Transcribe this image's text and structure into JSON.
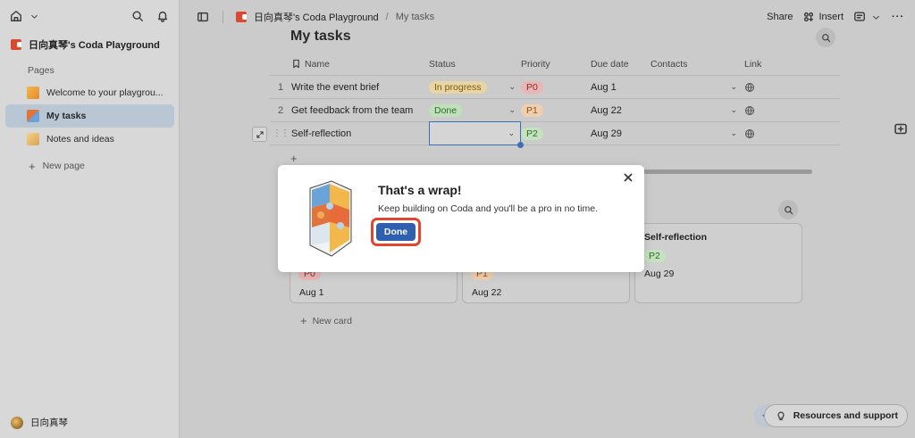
{
  "sidebar": {
    "doc_title": "日向真琴's Coda Playground",
    "pages_label": "Pages",
    "items": [
      {
        "label": "Welcome to your playgrou..."
      },
      {
        "label": "My tasks"
      },
      {
        "label": "Notes and ideas"
      }
    ],
    "new_page": "New page",
    "user_name": "日向真琴"
  },
  "header": {
    "breadcrumb_doc": "日向真琴's Coda Playground",
    "breadcrumb_sep": "/",
    "breadcrumb_page": "My tasks",
    "share": "Share",
    "insert": "Insert"
  },
  "page": {
    "title": "My tasks"
  },
  "table": {
    "columns": [
      "Name",
      "Status",
      "Priority",
      "Due date",
      "Contacts",
      "Link"
    ],
    "rows": [
      {
        "idx": "1",
        "name": "Write the event brief",
        "status": "In progress",
        "priority": "P0",
        "due": "Aug 1"
      },
      {
        "idx": "2",
        "name": "Get feedback from the team",
        "status": "Done",
        "priority": "P1",
        "due": "Aug 22"
      },
      {
        "idx": "",
        "name": "Self-reflection",
        "status": "",
        "priority": "P2",
        "due": "Aug 29"
      }
    ],
    "add_row": "+"
  },
  "board": {
    "cards": [
      {
        "title": "",
        "priority": "P0",
        "due": "Aug 1"
      },
      {
        "title": "",
        "priority": "P1",
        "due": "Aug 22"
      },
      {
        "title": "Self-reflection",
        "priority": "P2",
        "due": "Aug 29"
      }
    ],
    "new_card": "New card"
  },
  "footer": {
    "resources": "Resources and support"
  },
  "modal": {
    "title": "That's a wrap!",
    "body": "Keep building on Coda and you'll be a pro in no time.",
    "done": "Done"
  },
  "colors": {
    "accent": "#2f5fae",
    "highlight": "#e0452f",
    "brand": "#d9482f"
  }
}
